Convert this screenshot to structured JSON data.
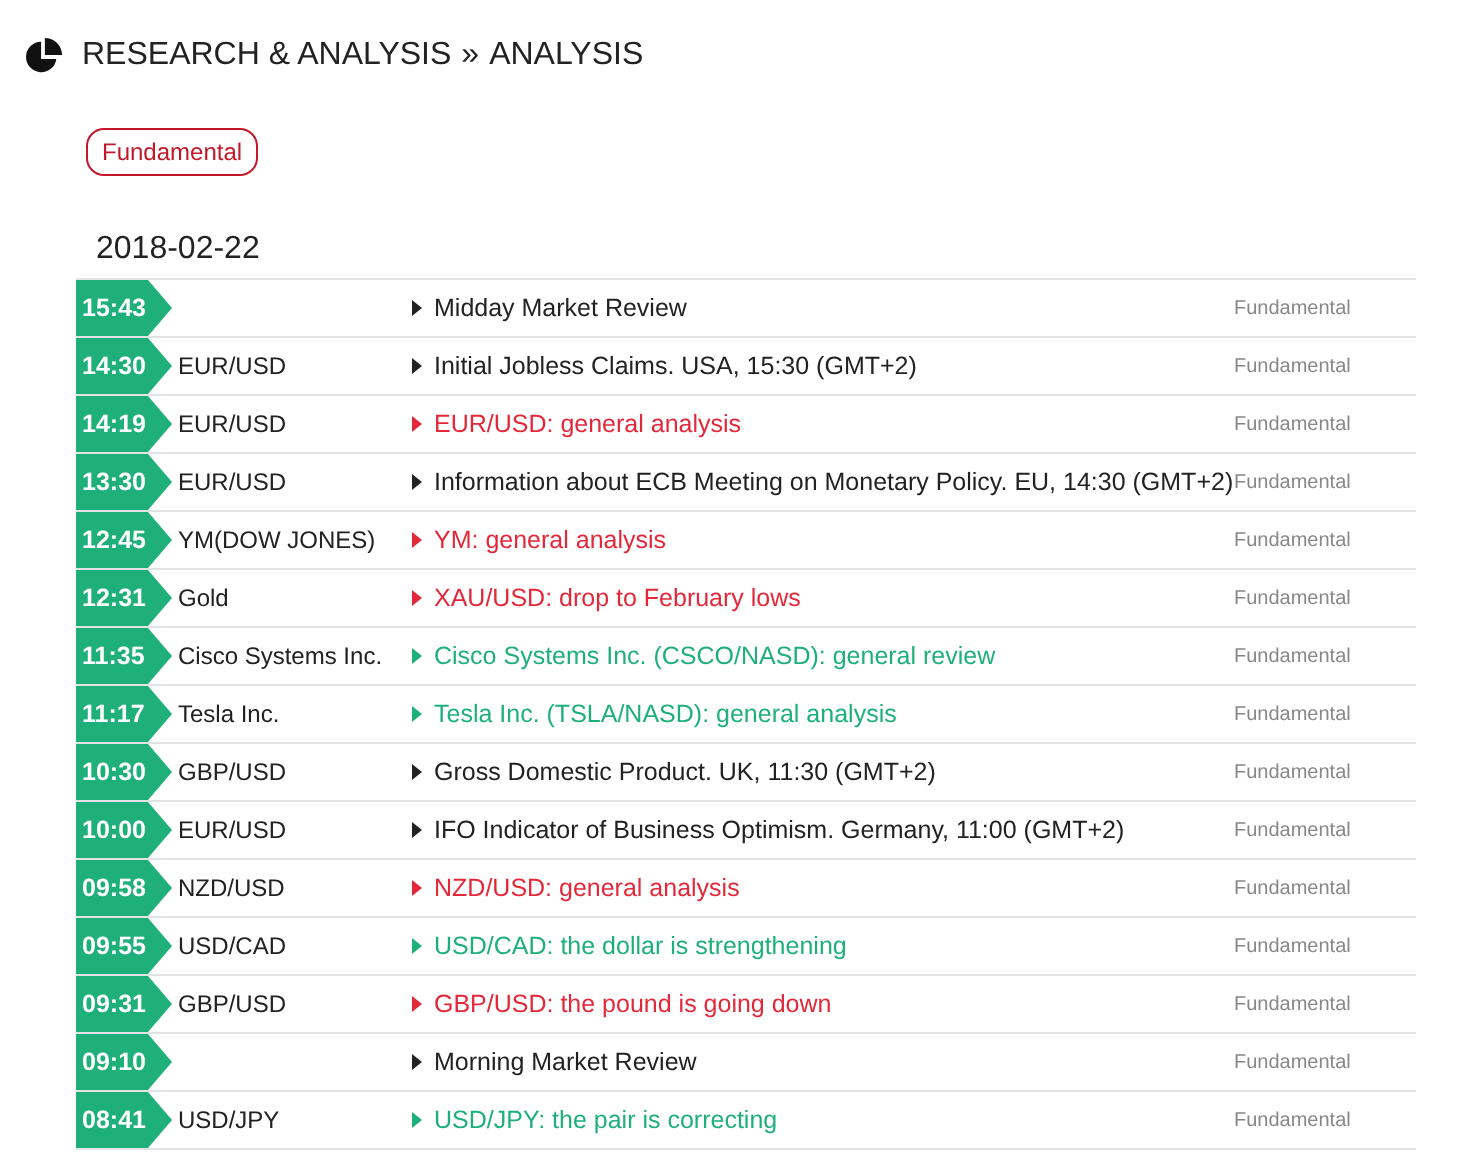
{
  "breadcrumb": {
    "section": "RESEARCH & ANALYSIS",
    "separator": "»",
    "page": "ANALYSIS"
  },
  "filter_tag": "Fundamental",
  "date": "2018-02-22",
  "rows": [
    {
      "time": "15:43",
      "asset": "",
      "title": "Midday Market Review",
      "kind": "neutral",
      "category": "Fundamental"
    },
    {
      "time": "14:30",
      "asset": "EUR/USD",
      "title": "Initial Jobless Claims. USA, 15:30 (GMT+2)",
      "kind": "neutral",
      "category": "Fundamental"
    },
    {
      "time": "14:19",
      "asset": "EUR/USD",
      "title": "EUR/USD: general analysis",
      "kind": "sell",
      "category": "Fundamental"
    },
    {
      "time": "13:30",
      "asset": "EUR/USD",
      "title": "Information about ECB Meeting on Monetary Policy. EU, 14:30 (GMT+2)",
      "kind": "neutral",
      "category": "Fundamental"
    },
    {
      "time": "12:45",
      "asset": "YM(DOW JONES)",
      "title": "YM: general analysis",
      "kind": "sell",
      "category": "Fundamental"
    },
    {
      "time": "12:31",
      "asset": "Gold",
      "title": "XAU/USD: drop to February lows",
      "kind": "sell",
      "category": "Fundamental"
    },
    {
      "time": "11:35",
      "asset": "Cisco Systems Inc.",
      "title": "Cisco Systems Inc. (CSCO/NASD): general review",
      "kind": "buy",
      "category": "Fundamental"
    },
    {
      "time": "11:17",
      "asset": "Tesla Inc.",
      "title": "Tesla Inc. (TSLA/NASD): general analysis",
      "kind": "buy",
      "category": "Fundamental"
    },
    {
      "time": "10:30",
      "asset": "GBP/USD",
      "title": "Gross Domestic Product. UK, 11:30 (GMT+2)",
      "kind": "neutral",
      "category": "Fundamental"
    },
    {
      "time": "10:00",
      "asset": "EUR/USD",
      "title": "IFO Indicator of Business Optimism. Germany, 11:00 (GMT+2)",
      "kind": "neutral",
      "category": "Fundamental"
    },
    {
      "time": "09:58",
      "asset": "NZD/USD",
      "title": "NZD/USD: general analysis",
      "kind": "sell",
      "category": "Fundamental"
    },
    {
      "time": "09:55",
      "asset": "USD/CAD",
      "title": "USD/CAD: the dollar is strengthening",
      "kind": "buy",
      "category": "Fundamental"
    },
    {
      "time": "09:31",
      "asset": "GBP/USD",
      "title": "GBP/USD: the pound is going down",
      "kind": "sell",
      "category": "Fundamental"
    },
    {
      "time": "09:10",
      "asset": "",
      "title": "Morning Market Review",
      "kind": "neutral",
      "category": "Fundamental"
    },
    {
      "time": "08:41",
      "asset": "USD/JPY",
      "title": "USD/JPY: the pair is correcting",
      "kind": "buy",
      "category": "Fundamental"
    }
  ]
}
